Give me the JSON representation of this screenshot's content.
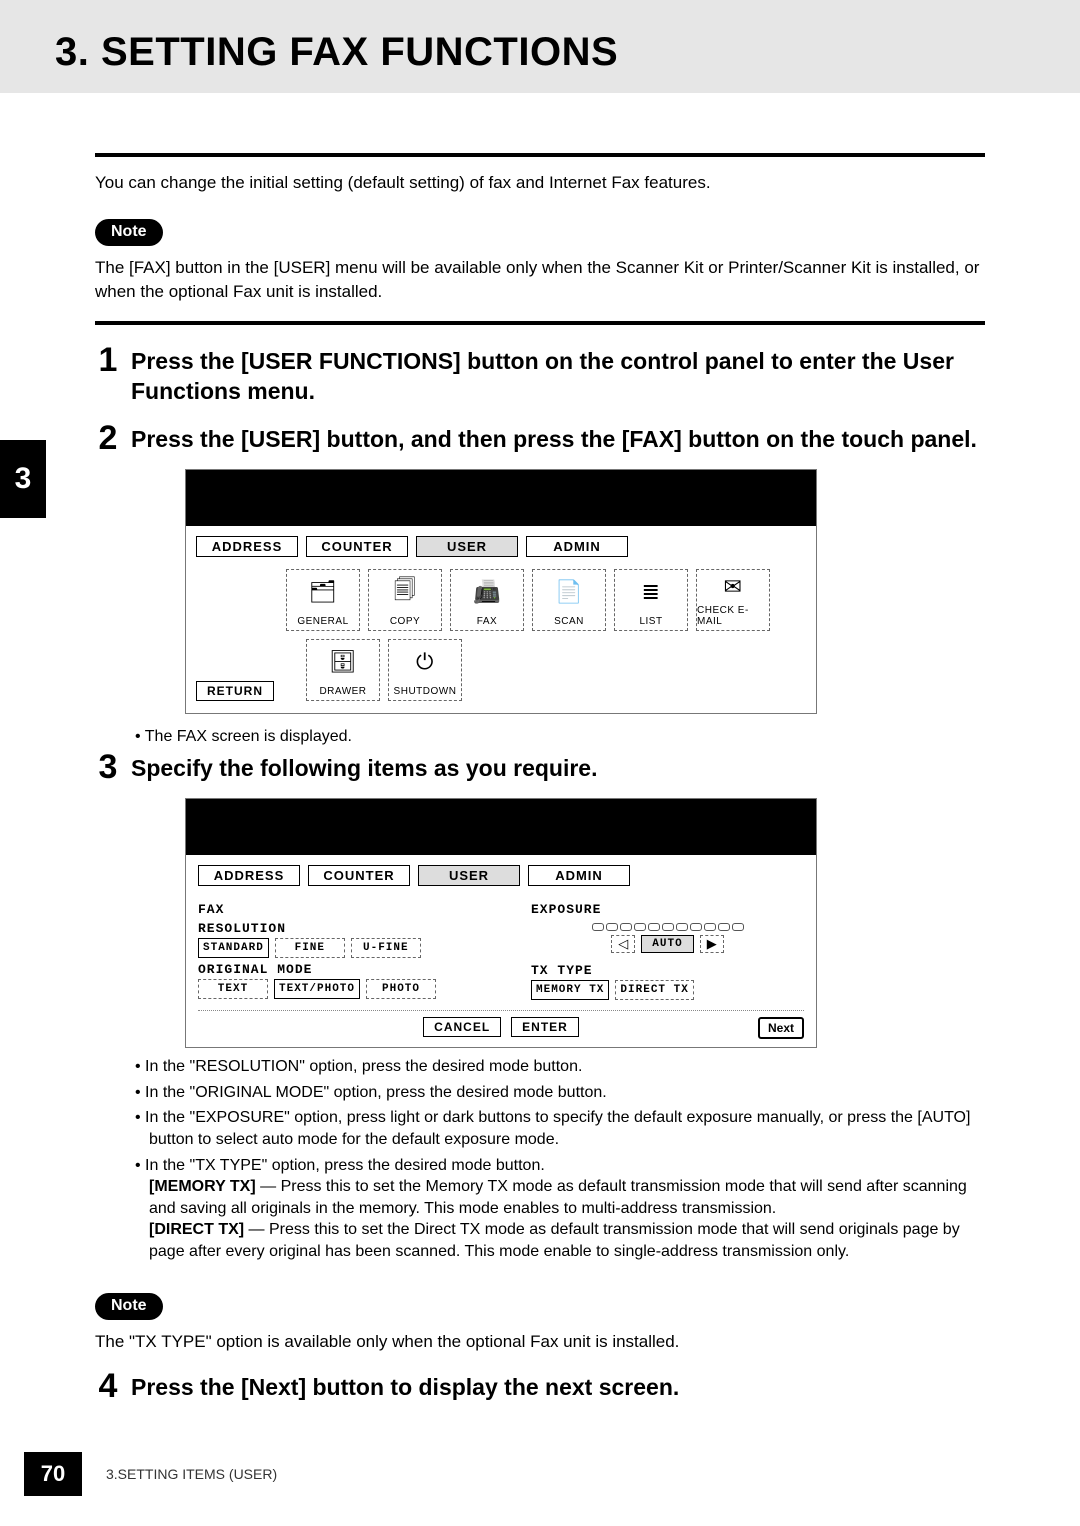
{
  "header": {
    "title": "3. SETTING FAX FUNCTIONS"
  },
  "sideTab": "3",
  "intro": "You can change the initial setting (default setting) of fax and Internet Fax features.",
  "note1": {
    "pill": "Note",
    "text": "The [FAX] button in the [USER] menu will be available only when the Scanner Kit or Printer/Scanner Kit is installed, or when the optional Fax unit is installed."
  },
  "steps": {
    "s1": {
      "num": "1",
      "head": "Press the [USER FUNCTIONS] button on the control panel to enter the User Functions menu."
    },
    "s2": {
      "num": "2",
      "head": "Press the [USER] button, and then press the [FAX] button on the touch panel.",
      "bullet": "The FAX screen is displayed."
    },
    "s3": {
      "num": "3",
      "head": "Specify the following items as you require."
    },
    "s4": {
      "num": "4",
      "head": "Press the [Next] button to display the next screen."
    }
  },
  "screen1": {
    "tabs": {
      "address": "ADDRESS",
      "counter": "COUNTER",
      "user": "USER",
      "admin": "ADMIN"
    },
    "icons": {
      "general": "GENERAL",
      "copy": "COPY",
      "fax": "FAX",
      "scan": "SCAN",
      "list": "LIST",
      "checkemail": "CHECK E-MAIL",
      "drawer": "DRAWER",
      "shutdown": "SHUTDOWN"
    },
    "return": "RETURN"
  },
  "screen2": {
    "tabs": {
      "address": "ADDRESS",
      "counter": "COUNTER",
      "user": "USER",
      "admin": "ADMIN"
    },
    "title": "FAX",
    "resolution": {
      "label": "RESOLUTION",
      "opts": {
        "standard": "STANDARD",
        "fine": "FINE",
        "ufine": "U-FINE"
      }
    },
    "origmode": {
      "label": "ORIGINAL MODE",
      "opts": {
        "text": "TEXT",
        "textphoto": "TEXT/PHOTO",
        "photo": "PHOTO"
      }
    },
    "exposure": {
      "label": "EXPOSURE",
      "auto": "AUTO"
    },
    "txtype": {
      "label": "TX TYPE",
      "opts": {
        "memory": "MEMORY TX",
        "direct": "DIRECT TX"
      }
    },
    "footer": {
      "cancel": "CANCEL",
      "enter": "ENTER",
      "next": "Next"
    }
  },
  "spec_bullets": {
    "b1": "In the \"RESOLUTION\" option, press the desired mode button.",
    "b2": "In the \"ORIGINAL MODE\" option, press the desired mode button.",
    "b3": "In the \"EXPOSURE\" option, press light or dark buttons to specify the default exposure manually, or press the [AUTO] button to select auto mode for the default exposure mode.",
    "b4": "In the \"TX TYPE\" option, press the desired mode button.",
    "b4_mem_label": "[MEMORY TX]",
    "b4_mem": " — Press this to set the Memory TX mode as default transmission mode that will send after scanning and saving all originals in the memory.  This mode enables to multi-address transmission.",
    "b4_dir_label": "[DIRECT TX]",
    "b4_dir": " — Press this to set the Direct TX mode as default transmission mode that will send originals page by page after every original has been scanned.  This mode enable to single-address transmission only."
  },
  "note2": {
    "pill": "Note",
    "text": "The \"TX TYPE\" option is available only when the optional Fax unit is installed."
  },
  "footer": {
    "pagenum": "70",
    "text": "3.SETTING ITEMS (USER)"
  }
}
